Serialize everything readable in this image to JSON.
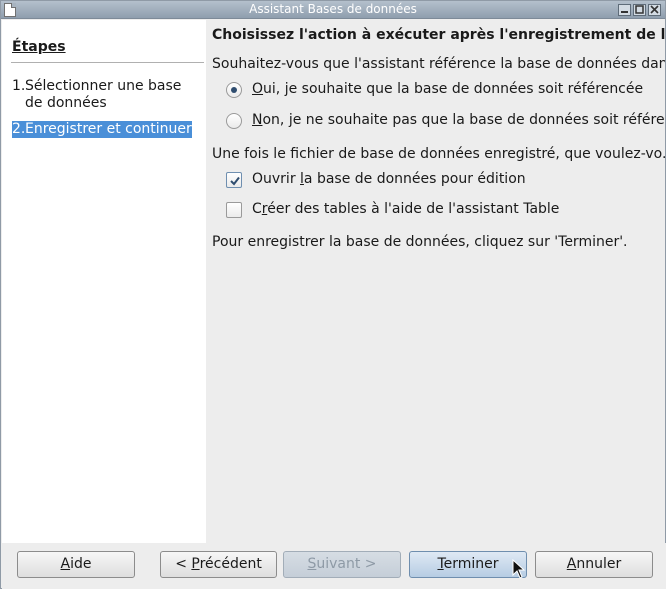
{
  "window": {
    "title": "Assistant Bases de données",
    "controls": [
      "minimize",
      "maximize",
      "close"
    ]
  },
  "steps": {
    "title": "Étapes",
    "items": [
      {
        "num": "1.",
        "label": "Sélectionner une base de données",
        "selected": false
      },
      {
        "num": "2.",
        "label": "Enregistrer et continuer",
        "selected": true
      }
    ]
  },
  "content": {
    "heading": "Choisissez l'action à exécuter après l'enregistrement de la bas",
    "question1": "Souhaitez-vous que l'assistant référence la base de données dan...",
    "radio_yes": {
      "accel": "O",
      "rest": "ui, je souhaite que la base de données soit référencée",
      "checked": true
    },
    "radio_no": {
      "accel": "N",
      "rest": "on, je ne souhaite pas que la base de données soit référenc",
      "checked": false
    },
    "question2": "Une fois le fichier de base de données enregistré, que voulez-vo...",
    "check_open": {
      "pre": "Ouvrir ",
      "accel": "l",
      "rest": "a base de données pour édition",
      "checked": true
    },
    "check_tables": {
      "pre": "C",
      "accel": "r",
      "rest": "éer des tables à l'aide de l'assistant Table",
      "checked": false
    },
    "footer_text": "Pour enregistrer la base de données, cliquez sur 'Terminer'."
  },
  "buttons": {
    "help": {
      "pre": "",
      "accel": "A",
      "rest": "ide"
    },
    "previous": {
      "pre": "< ",
      "accel": "P",
      "rest": "récédent"
    },
    "next": {
      "pre": "",
      "accel": "S",
      "rest": "uivant >",
      "disabled": true
    },
    "finish": {
      "pre": "",
      "accel": "T",
      "rest": "erminer",
      "default": true
    },
    "cancel": {
      "pre": "",
      "accel": "A",
      "rest": "nnuler"
    }
  }
}
